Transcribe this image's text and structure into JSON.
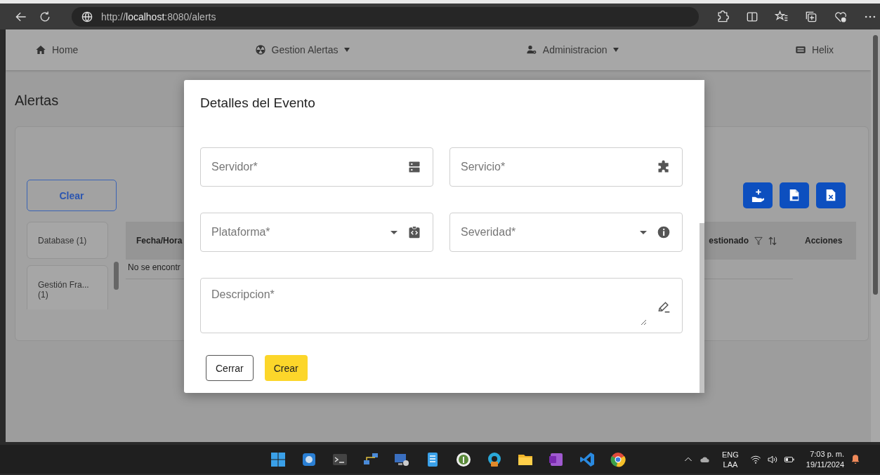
{
  "browser": {
    "url": "http://**localhost**:8080/alerts"
  },
  "nav": {
    "items": [
      {
        "label": "Home",
        "dropdown": false
      },
      {
        "label": "Gestion Alertas",
        "dropdown": true
      },
      {
        "label": "Administracion",
        "dropdown": true
      },
      {
        "label": "Helix",
        "dropdown": false
      }
    ]
  },
  "page": {
    "title": "Alertas",
    "clear_button": "Clear",
    "filters": [
      {
        "label": "Database (1)"
      },
      {
        "label": "Gestión Fra... (1)"
      }
    ],
    "table": {
      "columns": [
        {
          "label": "Fecha/Hora",
          "filter": false,
          "sort": false
        },
        {
          "label": "estionado",
          "filter": true,
          "sort": true
        },
        {
          "label": "Acciones",
          "filter": false,
          "sort": false
        }
      ],
      "empty_message": "No se encontr"
    }
  },
  "modal": {
    "title": "Detalles del Evento",
    "fields": [
      {
        "placeholder": "Servidor*",
        "kind": "text"
      },
      {
        "placeholder": "Servicio*",
        "kind": "text"
      },
      {
        "placeholder": "Plataforma*",
        "kind": "select"
      },
      {
        "placeholder": "Severidad*",
        "kind": "select"
      },
      {
        "placeholder": "Descripcion*",
        "kind": "textarea"
      }
    ],
    "buttons": [
      {
        "label": "Cerrar",
        "kind": "outlined"
      },
      {
        "label": "Crear",
        "kind": "filled"
      }
    ]
  },
  "taskbar": {
    "language": "ENG",
    "layout": "LAA",
    "time": "7:03 p. m.",
    "date": "19/11/2024"
  }
}
